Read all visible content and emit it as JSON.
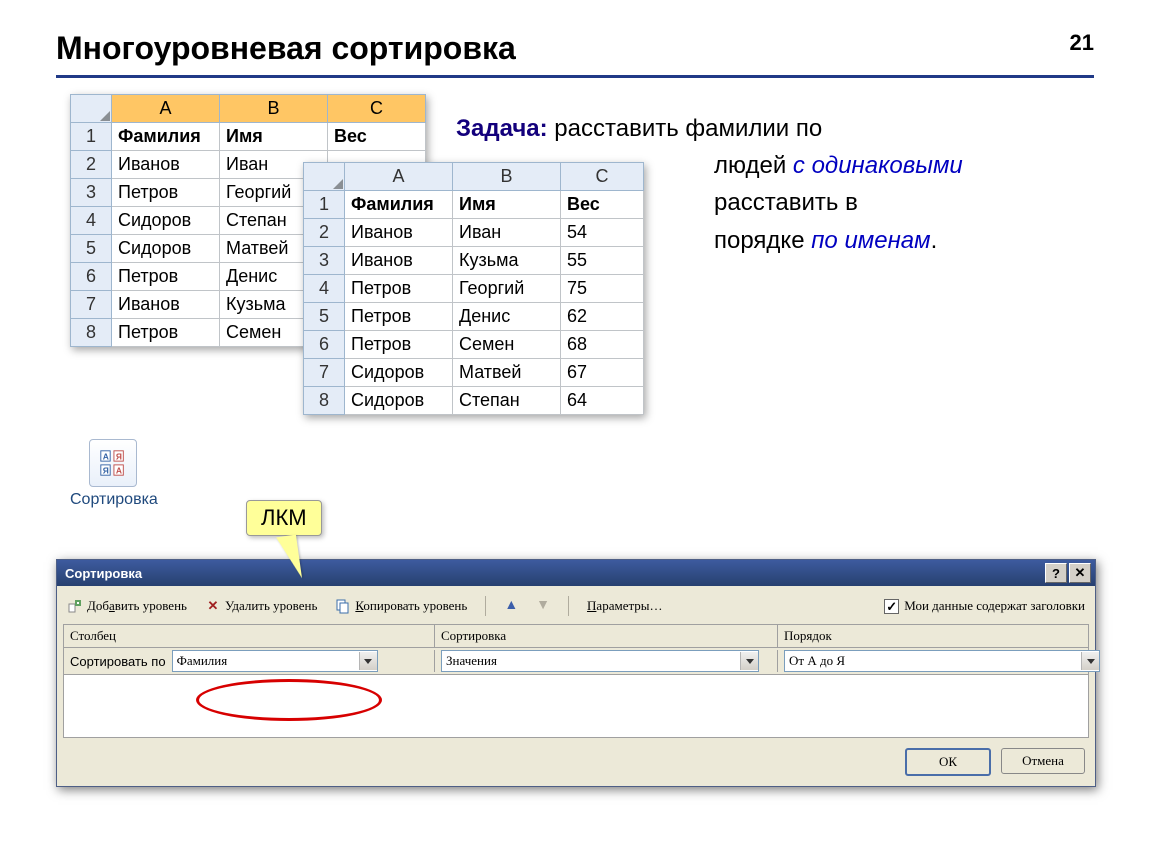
{
  "page_number": "21",
  "title": "Многоуровневая сортировка",
  "task": {
    "label": "Задача:",
    "line1": "  расставить фамилии по",
    "line2a": "людей ",
    "em1": "с одинаковыми",
    "line3": "расставить в",
    "line4a": "порядке ",
    "em2": "по именам",
    "dot": "."
  },
  "table1": {
    "cols": [
      "A",
      "B",
      "C"
    ],
    "header": [
      "Фамилия",
      "Имя",
      "Вес"
    ],
    "rows": [
      [
        "Иванов",
        "Иван"
      ],
      [
        "Петров",
        "Георгий"
      ],
      [
        "Сидоров",
        "Степан"
      ],
      [
        "Сидоров",
        "Матвей"
      ],
      [
        "Петров",
        "Денис"
      ],
      [
        "Иванов",
        "Кузьма"
      ],
      [
        "Петров",
        "Семен"
      ]
    ]
  },
  "table2": {
    "cols": [
      "A",
      "B",
      "C"
    ],
    "header": [
      "Фамилия",
      "Имя",
      "Вес"
    ],
    "rows": [
      [
        "Иванов",
        "Иван",
        "54"
      ],
      [
        "Иванов",
        "Кузьма",
        "55"
      ],
      [
        "Петров",
        "Георгий",
        "75"
      ],
      [
        "Петров",
        "Денис",
        "62"
      ],
      [
        "Петров",
        "Семен",
        "68"
      ],
      [
        "Сидоров",
        "Матвей",
        "67"
      ],
      [
        "Сидоров",
        "Степан",
        "64"
      ]
    ]
  },
  "sort_button_label": "Сортировка",
  "callout": "ЛКМ",
  "dialog": {
    "title": "Сортировка",
    "help": "?",
    "close": "✕",
    "add_level": "Добавить уровень",
    "delete_level": "Удалить уровень",
    "copy_level": "Копировать уровень",
    "params": "Параметры…",
    "headers_check": "Мои данные содержат заголовки",
    "col_header": "Столбец",
    "sort_header": "Сортировка",
    "order_header": "Порядок",
    "sort_by_label": "Сортировать по",
    "sort_by_value": "Фамилия",
    "sort_on_value": "Значения",
    "order_value": "От А до Я",
    "ok": "ОК",
    "cancel": "Отмена"
  }
}
